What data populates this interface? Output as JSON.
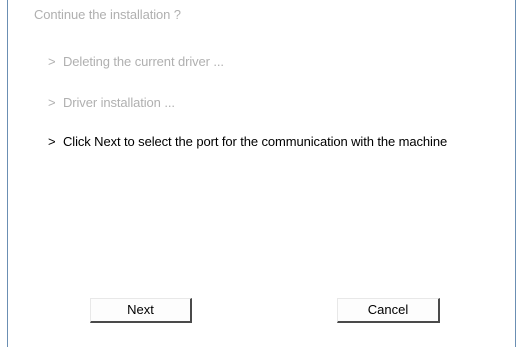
{
  "dialog": {
    "title": "Continue the installation ?",
    "steps": [
      {
        "arrow": ">",
        "label": "Deleting the current driver ..."
      },
      {
        "arrow": ">",
        "label": "Driver installation ..."
      },
      {
        "arrow": ">",
        "label": "Click Next to select the port for the communication with the machine"
      }
    ]
  },
  "buttons": {
    "next_label": "Next",
    "cancel_label": "Cancel"
  },
  "colors": {
    "dim_text": "#b0b0b0",
    "active_text": "#000000",
    "frame": "#6b8fb3"
  }
}
